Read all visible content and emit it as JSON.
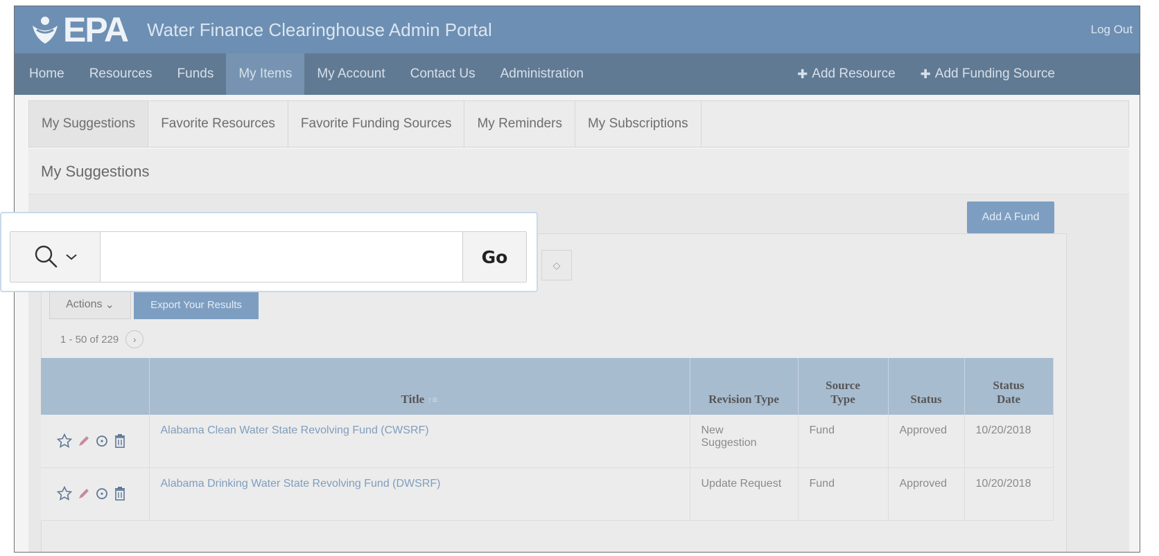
{
  "header": {
    "logo_text": "EPA",
    "portal_title": "Water Finance Clearinghouse Admin Portal",
    "logout": "Log Out"
  },
  "nav": {
    "items": [
      "Home",
      "Resources",
      "Funds",
      "My Items",
      "My Account",
      "Contact Us",
      "Administration"
    ],
    "active": "My Items",
    "add_resource": "Add Resource",
    "add_funding_source": "Add Funding Source"
  },
  "subtabs": [
    "My Suggestions",
    "Favorite Resources",
    "Favorite Funding Sources",
    "My Reminders",
    "My Subscriptions"
  ],
  "region": {
    "title": "My Suggestions",
    "add_fund": "Add A Fund"
  },
  "search": {
    "go_label": "Go",
    "value": ""
  },
  "toolbar": {
    "actions_label": "Actions",
    "export_label": "Export Your Results"
  },
  "pagination": {
    "range": "1 - 50 of 229"
  },
  "table": {
    "columns": {
      "title": "Title",
      "revision_type": "Revision Type",
      "source_type_1": "Source",
      "source_type_2": "Type",
      "status": "Status",
      "status_date_1": "Status",
      "status_date_2": "Date"
    },
    "rows": [
      {
        "title": "Alabama Clean Water State Revolving Fund (CWSRF)",
        "revision_type_1": "New",
        "revision_type_2": "Suggestion",
        "source_type": "Fund",
        "status": "Approved",
        "status_date": "10/20/2018"
      },
      {
        "title": "Alabama Drinking Water State Revolving Fund (DWSRF)",
        "revision_type_1": "Update Request",
        "revision_type_2": "",
        "source_type": "Fund",
        "status": "Approved",
        "status_date": "10/20/2018"
      }
    ]
  },
  "colors": {
    "header_bg": "#6d8fb3",
    "nav_bg": "#617a93",
    "nav_active_bg": "#7694b2",
    "button_blue": "#7d9ec1",
    "table_header_bg": "#a8bcd0"
  }
}
